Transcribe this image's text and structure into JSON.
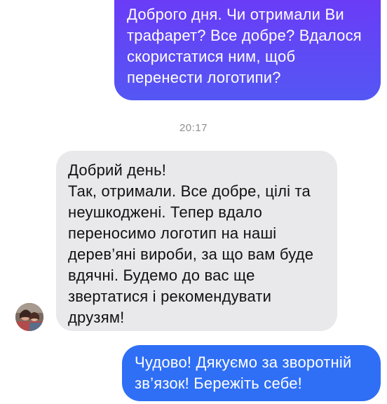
{
  "messages": [
    {
      "direction": "outgoing",
      "text": "Доброго дня. Чи отримали Ви\nтрафарет? Все добре? Вдалося\nскористатися ним, щоб\nперенести логотипи?"
    },
    {
      "direction": "incoming",
      "text": "Добрий день!\nТак, отримали. Все добре, цілі та\nнеушкоджені. Тепер  вдало\nпереносимо логотип на наші\nдерев’яні вироби, за що вам буде\nвдячні. Будемо до вас ще\nзвертатися і рекомендувати\nдрузям!"
    },
    {
      "direction": "outgoing",
      "text": "Чудово! Дякуємо за зворотній\nзв’язок! Бережіть себе!"
    }
  ],
  "timestamp": "20:17",
  "avatar": {
    "icon": "contact-avatar-icon"
  },
  "colors": {
    "outgoing_gradient_top": "#6a3cf6",
    "outgoing_gradient_bottom": "#5457f4",
    "outgoing_blue": "#2f6ff5",
    "incoming_bg": "#e9e9eb",
    "timestamp": "#8e8e93"
  }
}
